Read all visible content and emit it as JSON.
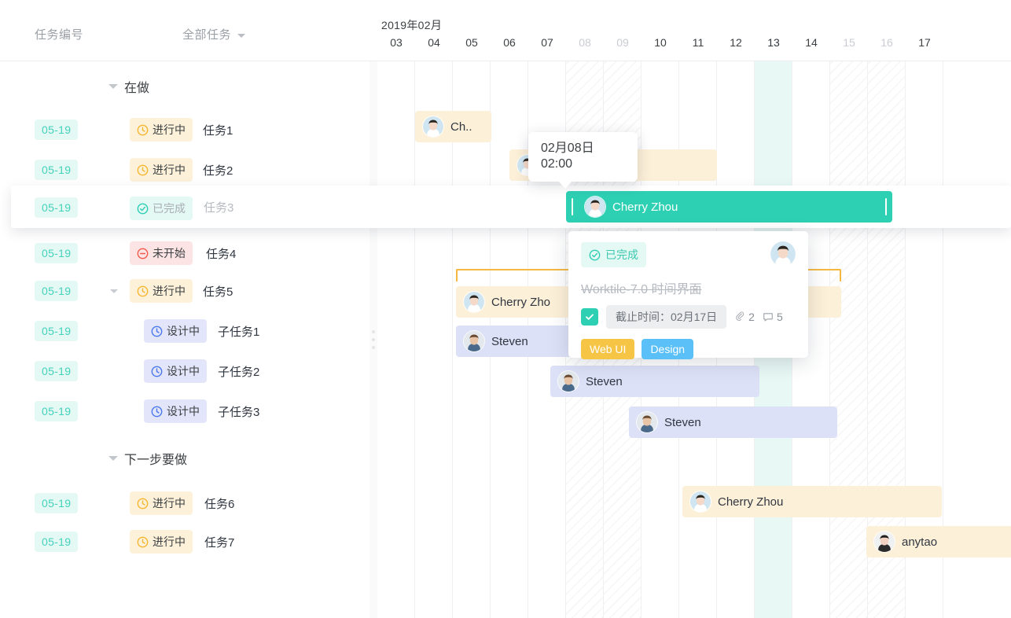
{
  "header": {
    "id_column_label": "任务编号",
    "task_filter_label": "全部任务",
    "month_label": "2019年02月"
  },
  "timeline": {
    "days": [
      {
        "label": "03",
        "weekend": false
      },
      {
        "label": "04",
        "weekend": false
      },
      {
        "label": "05",
        "weekend": false
      },
      {
        "label": "06",
        "weekend": false
      },
      {
        "label": "07",
        "weekend": false
      },
      {
        "label": "08",
        "weekend": true
      },
      {
        "label": "09",
        "weekend": true
      },
      {
        "label": "10",
        "weekend": false
      },
      {
        "label": "11",
        "weekend": false
      },
      {
        "label": "12",
        "weekend": false
      },
      {
        "label": "13",
        "weekend": false,
        "today": true
      },
      {
        "label": "14",
        "weekend": false
      },
      {
        "label": "15",
        "weekend": true
      },
      {
        "label": "16",
        "weekend": true
      },
      {
        "label": "17",
        "weekend": false
      }
    ]
  },
  "groups": [
    {
      "title": "在做",
      "add_label": "+"
    },
    {
      "title": "下一步要做",
      "add_label": "+"
    }
  ],
  "tasks": [
    {
      "date": "05-19",
      "status": "进行中",
      "status_type": "progress",
      "title": "任务1"
    },
    {
      "date": "05-19",
      "status": "进行中",
      "status_type": "progress",
      "title": "任务2"
    },
    {
      "date": "05-19",
      "status": "已完成",
      "status_type": "done",
      "title": "任务3"
    },
    {
      "date": "05-19",
      "status": "未开始",
      "status_type": "notstarted",
      "title": "任务4"
    },
    {
      "date": "05-19",
      "status": "进行中",
      "status_type": "progress",
      "title": "任务5"
    },
    {
      "date": "05-19",
      "status": "设计中",
      "status_type": "design",
      "title": "子任务1"
    },
    {
      "date": "05-19",
      "status": "设计中",
      "status_type": "design",
      "title": "子任务2"
    },
    {
      "date": "05-19",
      "status": "设计中",
      "status_type": "design",
      "title": "子任务3"
    },
    {
      "date": "05-19",
      "status": "进行中",
      "status_type": "progress",
      "title": "任务6"
    },
    {
      "date": "05-19",
      "status": "进行中",
      "status_type": "progress",
      "title": "任务7"
    }
  ],
  "bars": [
    {
      "label": "Ch..",
      "color": "orange",
      "avatar": "cherry"
    },
    {
      "label": "",
      "color": "orange",
      "avatar": "cherry"
    },
    {
      "label": "Cherry Zhou",
      "color": "active",
      "avatar": "cherry"
    },
    {
      "label": "Cherry Zho",
      "color": "orange",
      "avatar": "cherry"
    },
    {
      "label": "Steven",
      "color": "lav",
      "avatar": "steven"
    },
    {
      "label": "Steven",
      "color": "lav",
      "avatar": "steven"
    },
    {
      "label": "Steven",
      "color": "lav",
      "avatar": "steven"
    },
    {
      "label": "Cherry Zhou",
      "color": "orange",
      "avatar": "cherry"
    },
    {
      "label": "anytao",
      "color": "orange",
      "avatar": "anytao"
    }
  ],
  "tooltip": {
    "date": "02月08日",
    "time": "02:00"
  },
  "detail_card": {
    "status": "已完成",
    "title": "Worktile-7.0 时间界面",
    "due_label": "截止时间：02月17日",
    "attachments": "2",
    "comments": "5",
    "tags": [
      {
        "label": "Web UI",
        "color": "#f7c546"
      },
      {
        "label": "Design",
        "color": "#5bc0f8"
      }
    ]
  },
  "colors": {
    "accent_teal": "#2ed0b4",
    "date_chip_text": "#43d2bb",
    "date_chip_bg": "#e4f8f4",
    "bar_orange": "#fdf0d8",
    "bar_lavender": "#dde1f7",
    "bracket_orange": "#f5b942",
    "today_column": "#e8f8f4"
  }
}
